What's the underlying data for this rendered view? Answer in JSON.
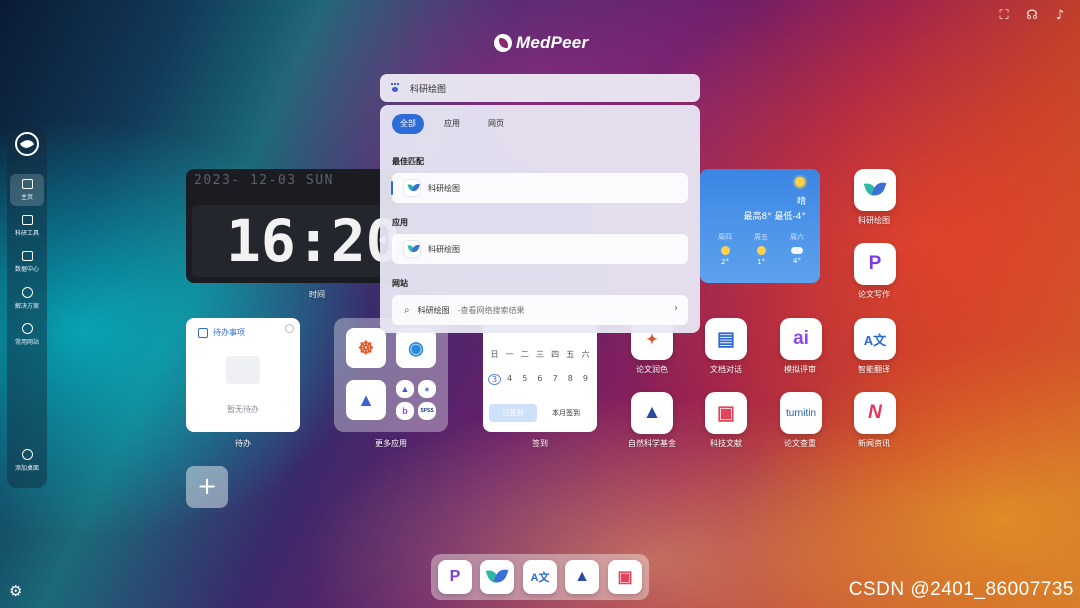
{
  "brand": {
    "name": "MedPeer"
  },
  "top_icons": [
    {
      "icon": "fullscreen-icon",
      "glyph": "⛶"
    },
    {
      "icon": "headset-icon",
      "glyph": "🎧"
    },
    {
      "icon": "bell-icon",
      "glyph": "🔔"
    }
  ],
  "sidebar": {
    "items": [
      {
        "label": "主页",
        "icon": "home-icon",
        "active": true
      },
      {
        "label": "科研工具",
        "icon": "briefcase-icon"
      },
      {
        "label": "数据中心",
        "icon": "database-icon"
      },
      {
        "label": "解决方案",
        "icon": "solution-icon"
      },
      {
        "label": "常用网站",
        "icon": "globe-icon"
      }
    ],
    "add_desktop": "添加桌面",
    "settings_glyph": "⚙"
  },
  "clock": {
    "date": "2023- 12-03  SUN",
    "time": "16:20:0",
    "label": "时间"
  },
  "weather": {
    "condition": "晴",
    "range": "最高8°  最低-4°",
    "forecast": [
      {
        "day": "周四",
        "temp": "2°",
        "icon": "sun"
      },
      {
        "day": "周五",
        "temp": "1°",
        "icon": "sun"
      },
      {
        "day": "周六",
        "temp": "4°",
        "icon": "cloud"
      }
    ]
  },
  "todo": {
    "title": "待办事项",
    "empty": "暂无待办",
    "label": "待办"
  },
  "more_apps": {
    "label": "更多应用"
  },
  "signin": {
    "weekdays": [
      "日",
      "一",
      "二",
      "三",
      "四",
      "五",
      "六"
    ],
    "days": [
      "3",
      "4",
      "5",
      "6",
      "7",
      "8",
      "9"
    ],
    "signed": "已签到",
    "month": "本月签到",
    "label": "签到"
  },
  "search": {
    "query": "科研绘图",
    "tabs": [
      "全部",
      "应用",
      "网页"
    ],
    "sections": {
      "best": "最佳匹配",
      "apps": "应用",
      "web": "网站"
    },
    "best_result": "科研绘图",
    "app_result": "科研绘图",
    "web_result": "科研绘图",
    "web_hint": "-查看网络搜索结果"
  },
  "apps": [
    {
      "label": "科研绘图",
      "glyph": "",
      "color": "#3b6fd8"
    },
    {
      "label": "论文写作",
      "glyph": "P",
      "color": "#7b3fe0"
    },
    {
      "label": "论文润色",
      "glyph": "",
      "color": "#d4573a"
    },
    {
      "label": "文档对话",
      "glyph": "▤",
      "color": "#2c67d6"
    },
    {
      "label": "模拟评审",
      "glyph": "ai",
      "color": "#8a4be0"
    },
    {
      "label": "智能翻译",
      "glyph": "A文",
      "color": "#2c67d6"
    },
    {
      "label": "自然科学基金",
      "glyph": "▲",
      "color": "#2c4aa0"
    },
    {
      "label": "科技文献",
      "glyph": "▣",
      "color": "#e0455a"
    },
    {
      "label": "论文查重",
      "glyph": "turnitin",
      "color": "#1a5fa8"
    },
    {
      "label": "新闻资讯",
      "glyph": "N",
      "color": "#e8335a"
    }
  ],
  "watermark": "CSDN @2401_86007735",
  "colors": {
    "accent": "#2d6bd6",
    "weather_bg": "#3b86e4"
  }
}
